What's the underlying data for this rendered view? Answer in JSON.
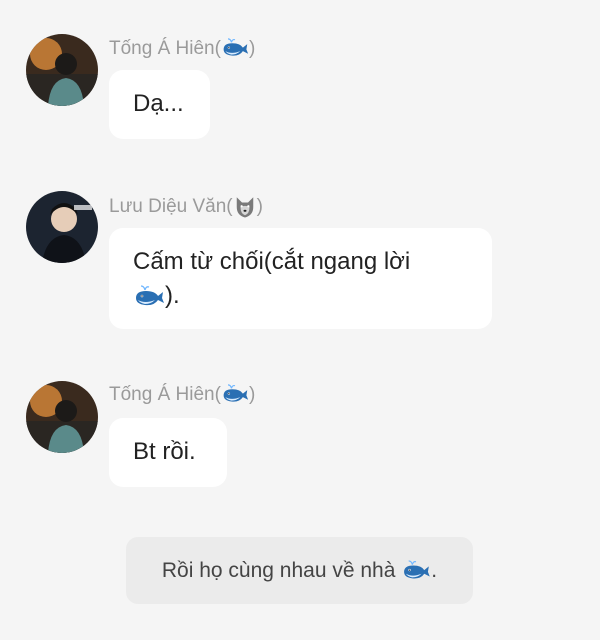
{
  "messages": [
    {
      "sender": "Tống Á Hiên",
      "sender_emoji": "whale-icon",
      "text": "Dạ..."
    },
    {
      "sender": "Lưu Diệu Văn",
      "sender_emoji": "wolf-icon",
      "text_line1": "Cấm từ chối(cắt ngang lời",
      "text_line2": ")."
    },
    {
      "sender": "Tống Á Hiên",
      "sender_emoji": "whale-icon",
      "text": "Bt rồi."
    }
  ],
  "narration": {
    "text": "Rồi họ cùng nhau về nhà",
    "suffix": "."
  },
  "colors": {
    "background": "#f5f5f5",
    "bubble": "#ffffff",
    "narration_bg": "#ebebeb",
    "name": "#9a9a9a",
    "whale": "#2a6fb3",
    "wolf": "#7a7a7a"
  }
}
